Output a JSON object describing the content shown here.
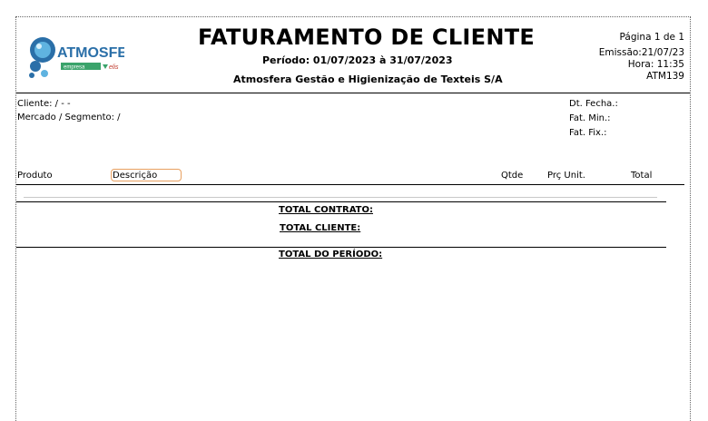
{
  "header": {
    "title": "FATURAMENTO DE CLIENTE",
    "period": "Período: 01/07/2023 à 31/07/2023",
    "company": "Atmosfera Gestão e Higienização de Texteis S/A"
  },
  "logo": {
    "brand": "ATMOSFERA",
    "tagline": "empresa",
    "partner": "elis"
  },
  "meta": {
    "page": "Página 1 de 1",
    "emission": "Emissão:21/07/23",
    "time": "Hora: 11:35",
    "code": "ATM139"
  },
  "client_info": {
    "client": "Cliente:  /  -  -",
    "segment": "Mercado / Segmento:  /"
  },
  "right_info": {
    "close_date": "Dt. Fecha.:",
    "fat_min": "Fat. Min.:",
    "fat_fix": "Fat. Fix.:"
  },
  "columns": {
    "product": "Produto",
    "description": "Descrição",
    "qty": "Qtde",
    "unit_price": "Prç Unit.",
    "total": "Total"
  },
  "totals": {
    "contract": "TOTAL CONTRATO:",
    "client": "TOTAL CLIENTE:",
    "period": "TOTAL DO PERÍODO:"
  },
  "colors": {
    "logo_blue": "#2a6fa8",
    "logo_green": "#3aa36b",
    "focus_border": "#e8a060"
  }
}
